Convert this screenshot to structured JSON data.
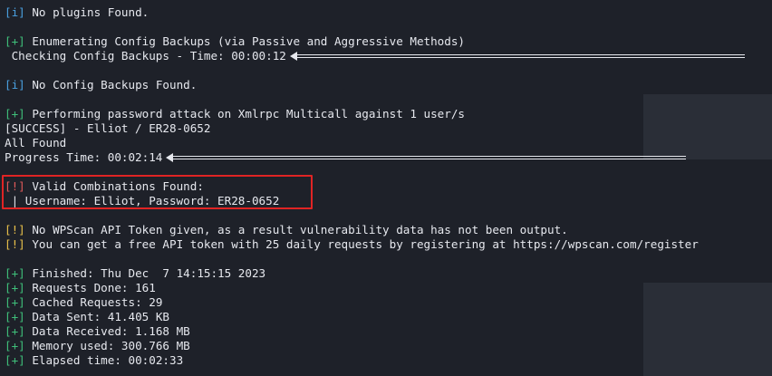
{
  "colors": {
    "background": "#1e2129",
    "text": "#e6e8ee",
    "info": "#4aa0e0",
    "plus": "#3fbf7a",
    "warn": "#e8c04a",
    "alert": "#e05a5a",
    "highlight": "#e02424"
  },
  "icons": {
    "progress_arrow": "left-arrow-bar-icon"
  },
  "tags": {
    "info": "[i]",
    "plus": "[+]",
    "warn": "[!]",
    "alert": "[!]"
  },
  "lines": {
    "no_plugins": "No plugins Found.",
    "enum_config": "Enumerating Config Backups (via Passive and Aggressive Methods)",
    "checking_config": " Checking Config Backups - Time: 00:00:12",
    "no_config": "No Config Backups Found.",
    "performing_attack": "Performing password attack on Xmlrpc Multicall against 1 user/s",
    "success": "[SUCCESS] - Elliot / ER28-0652",
    "all_found": "All Found",
    "progress_time": "Progress Time: 00:02:14",
    "valid_combos": "Valid Combinations Found:",
    "credentials": " | Username: Elliot, Password: ER28-0652",
    "no_token": "No WPScan API Token given, as a result vulnerability data has not been output.",
    "free_token": "You can get a free API token with 25 daily requests by registering at https://wpscan.com/register",
    "finished": "Finished: Thu Dec  7 14:15:15 2023",
    "requests_done": "Requests Done: 161",
    "cached_requests": "Cached Requests: 29",
    "data_sent": "Data Sent: 41.405 KB",
    "data_received": "Data Received: 1.168 MB",
    "memory_used": "Memory used: 300.766 MB",
    "elapsed_time": "Elapsed time: 00:02:33"
  }
}
